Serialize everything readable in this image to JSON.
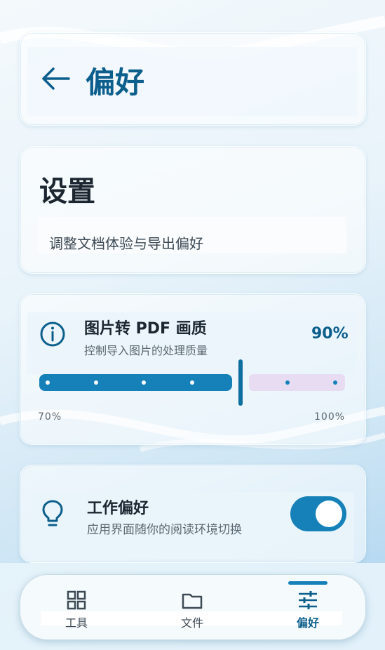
{
  "header": {
    "title": "偏好",
    "back_icon": "arrow-left-icon"
  },
  "settings": {
    "title": "设置",
    "subtitle": "调整文档体验与导出偏好"
  },
  "image_quality": {
    "icon": "info-icon",
    "title": "图片转 PDF 画质",
    "subtitle": "控制导入图片的处理质量",
    "value_label": "90%",
    "min_label": "70%",
    "max_label": "100%",
    "value_fraction": 0.667
  },
  "work_pref": {
    "icon": "lightbulb-icon",
    "title": "工作偏好",
    "subtitle": "应用界面随你的阅读环境切换",
    "toggle_on": true
  },
  "nav": {
    "items": [
      {
        "label": "工具",
        "icon": "grid-icon"
      },
      {
        "label": "文件",
        "icon": "folder-icon"
      },
      {
        "label": "偏好",
        "icon": "sliders-icon"
      }
    ],
    "active_index": 2
  },
  "colors": {
    "accent": "#1581b8",
    "title": "#0c5f8c",
    "track_inactive": "#e8dcf2"
  }
}
